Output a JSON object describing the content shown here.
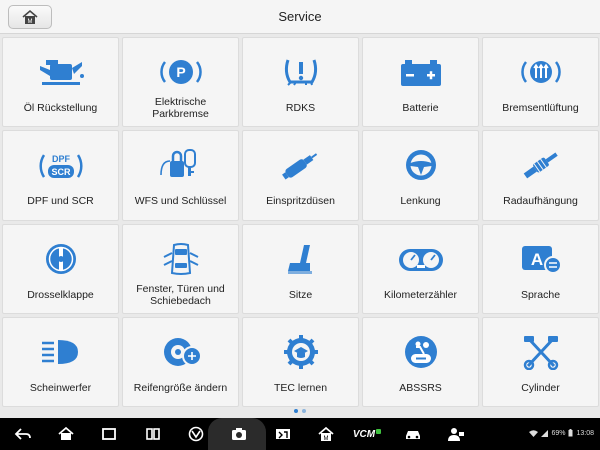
{
  "header": {
    "title": "Service",
    "home_icon": "home-icon"
  },
  "accent_color": "#2f7fd1",
  "tiles": [
    {
      "label": "Öl Rückstellung",
      "icon": "oil-can-icon"
    },
    {
      "label": "Elektrische Parkbremse",
      "icon": "parking-brake-icon"
    },
    {
      "label": "RDKS",
      "icon": "tire-pressure-icon"
    },
    {
      "label": "Batterie",
      "icon": "battery-icon"
    },
    {
      "label": "Bremsentlüftung",
      "icon": "brake-bleed-icon"
    },
    {
      "label": "DPF und SCR",
      "icon": "dpf-scr-icon"
    },
    {
      "label": "WFS und Schlüssel",
      "icon": "immobilizer-key-icon"
    },
    {
      "label": "Einspritzdüsen",
      "icon": "injector-icon"
    },
    {
      "label": "Lenkung",
      "icon": "steering-wheel-icon"
    },
    {
      "label": "Radaufhängung",
      "icon": "suspension-icon"
    },
    {
      "label": "Drosselklappe",
      "icon": "throttle-icon"
    },
    {
      "label": "Fenster, Türen und Schiebedach",
      "icon": "car-doors-icon"
    },
    {
      "label": "Sitze",
      "icon": "seat-icon"
    },
    {
      "label": "Kilometerzähler",
      "icon": "odometer-icon"
    },
    {
      "label": "Sprache",
      "icon": "language-icon"
    },
    {
      "label": "Scheinwerfer",
      "icon": "headlight-icon"
    },
    {
      "label": "Reifengröße ändern",
      "icon": "tire-size-icon"
    },
    {
      "label": "TEC lernen",
      "icon": "tec-learn-icon"
    },
    {
      "label": "ABSSRS",
      "icon": "abs-srs-icon"
    },
    {
      "label": "Cylinder",
      "icon": "cylinder-icon"
    }
  ],
  "navbar": {
    "vcm_label": "VCM",
    "battery": "69%",
    "time": "13:08"
  }
}
